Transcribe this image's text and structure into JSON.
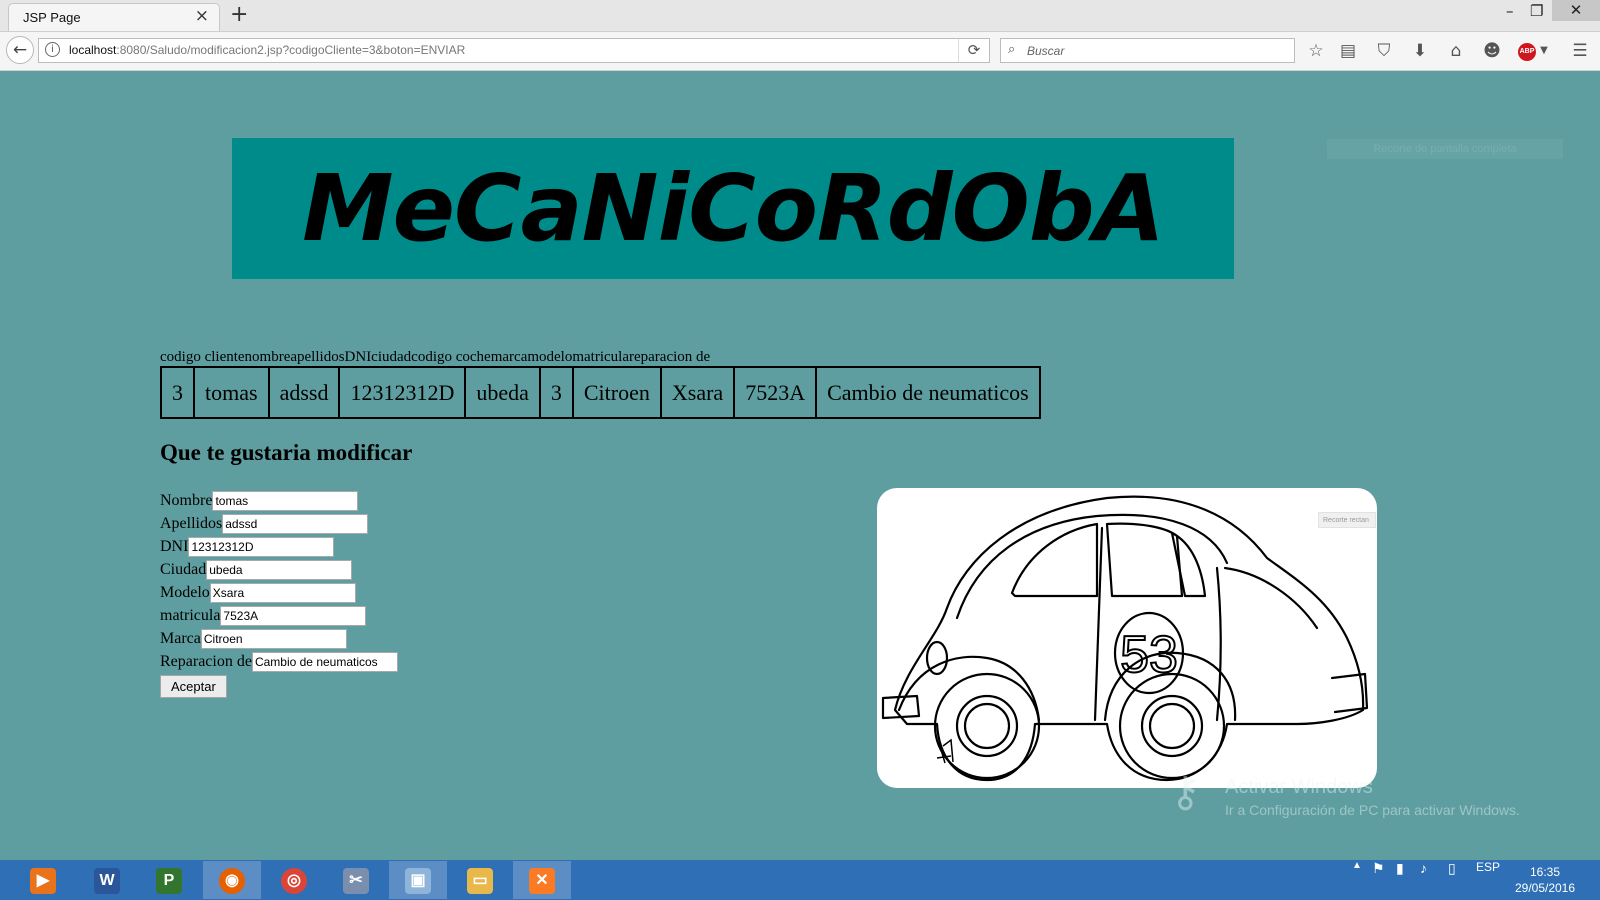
{
  "browser": {
    "tab_title": "JSP Page",
    "tab_close": "×",
    "new_tab": "+",
    "url_host": "localhost",
    "url_rest": ":8080/Saludo/modificacion2.jsp?codigoCliente=3&boton=ENVIAR",
    "search_placeholder": "Buscar",
    "window_controls": {
      "minimize": "–",
      "restore": "❐",
      "close": "✕"
    },
    "abp_label": "ABP"
  },
  "banner": {
    "title": "MeCaNiCoRdObA"
  },
  "ghost_tooltip": "Recorte de pantalla completa",
  "table": {
    "header_text": "codigo clientenombreapellidosDNIciudadcodigo cochemarcamodelomatriculareparacion de",
    "cells": [
      "3",
      "tomas",
      "adssd",
      "12312312D",
      "ubeda",
      "3",
      "Citroen",
      "Xsara",
      "7523A",
      "Cambio de neumaticos"
    ]
  },
  "form": {
    "heading": "Que te gustaria modificar",
    "fields": [
      {
        "label": "Nombre",
        "value": "tomas"
      },
      {
        "label": "Apellidos",
        "value": "adssd"
      },
      {
        "label": "DNI",
        "value": "12312312D"
      },
      {
        "label": "Ciudad",
        "value": "ubeda"
      },
      {
        "label": "Modelo",
        "value": "Xsara"
      },
      {
        "label": "matricula",
        "value": "7523A"
      },
      {
        "label": "Marca",
        "value": "Citroen"
      },
      {
        "label": "Reparacion de",
        "value": "Cambio de neumaticos"
      }
    ],
    "submit_label": "Aceptar"
  },
  "car_image": {
    "number": "53",
    "mini_tip": "Recorte rectan"
  },
  "watermark": {
    "title": "Activar Windows",
    "subtitle": "Ir a Configuración de PC para activar Windows."
  },
  "taskbar": {
    "language": "ESP",
    "time": "16:35",
    "date": "29/05/2016"
  },
  "colors": {
    "page_background": "#5f9ea0",
    "banner_background": "#008b8b",
    "taskbar": "#2f6fb5"
  }
}
